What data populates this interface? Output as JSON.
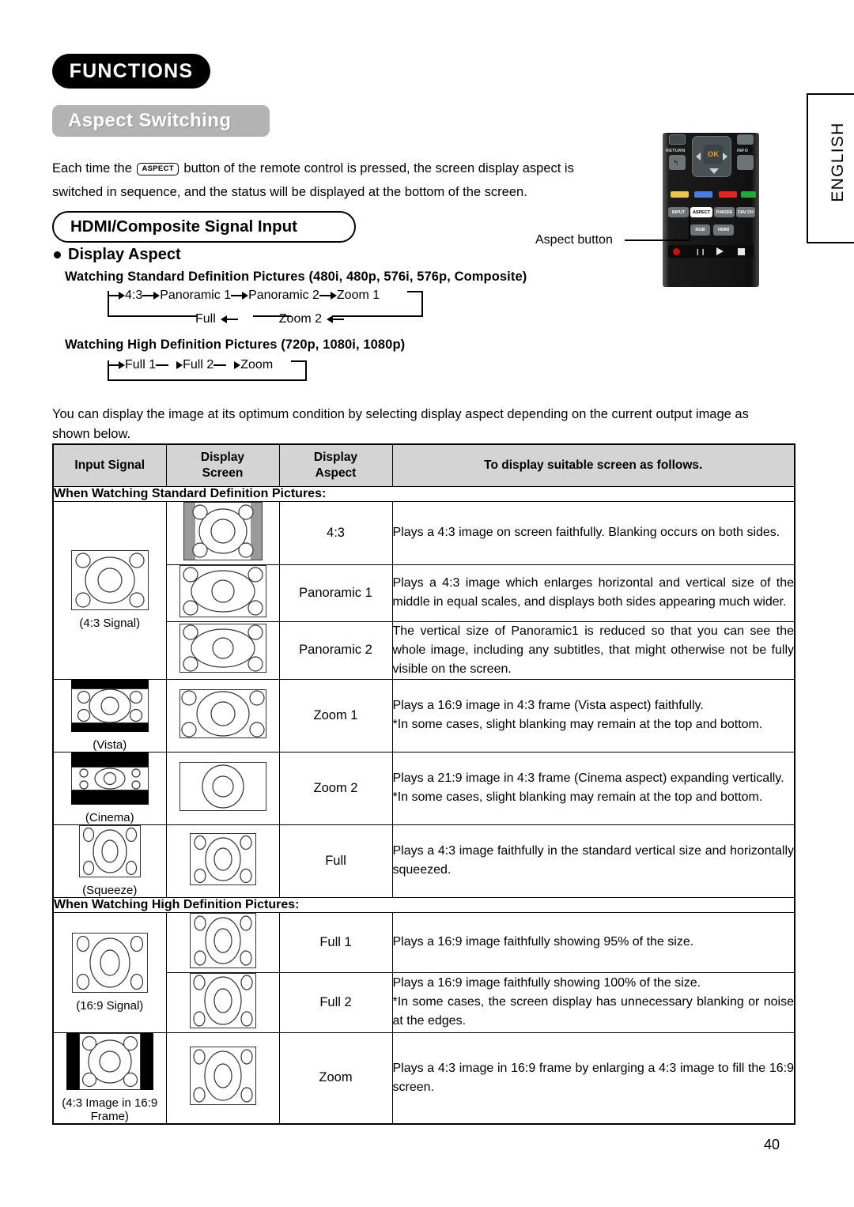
{
  "header": {
    "section_badge": "FUNCTIONS",
    "title_badge": "Aspect Switching"
  },
  "intro": {
    "before_key": "Each time the",
    "key_label": "ASPECT",
    "after_key": "button of the remote control is pressed, the screen display aspect is switched in sequence, and the status will be displayed at the bottom of the screen."
  },
  "hdmi_section": {
    "capsule_title": "HDMI/Composite Signal Input",
    "display_aspect_label": "Display Aspect",
    "sd_heading": "Watching Standard Definition Pictures (480i, 480p, 576i, 576p, Composite)",
    "hd_heading": "Watching High Definition Pictures (720p, 1080i, 1080p)",
    "sd_flow_top": [
      "4:3",
      "Panoramic 1",
      "Panoramic 2",
      "Zoom 1"
    ],
    "sd_flow_bottom": [
      "Full",
      "Zoom 2"
    ],
    "hd_flow": [
      "Full 1",
      "Full 2",
      "Zoom"
    ]
  },
  "remote": {
    "return_label": "RETURN",
    "ok_label": "OK",
    "info_label": "INFO",
    "keys": [
      "INPUT",
      "ASPECT",
      "P.MODE",
      "FAV CH"
    ],
    "source_keys": [
      "RGB",
      "HDMI"
    ],
    "color_keys": [
      "#e8c55a",
      "#4a7ddd",
      "#e22424",
      "#24a838"
    ],
    "callout": "Aspect button"
  },
  "sidebar": {
    "language_label": "ENGLISH"
  },
  "body_paragraph": "You can display the image at its optimum condition by selecting display aspect depending on the current output image as shown below.",
  "table": {
    "headers": [
      "Input Signal",
      "Display Screen",
      "Display Aspect",
      "To display suitable screen as follows."
    ],
    "section_sd": "When Watching Standard Definition Pictures:",
    "section_hd": "When Watching High Definition Pictures:",
    "input_labels": {
      "sd43": "(4:3 Signal)",
      "vista": "(Vista)",
      "cinema": "(Cinema)",
      "squeeze": "(Squeeze)",
      "hd169": "(16:9 Signal)",
      "frame43": "(4:3 Image in 16:9 Frame)"
    },
    "rows_sd": [
      {
        "aspect": "4:3",
        "desc": "Plays a 4:3 image on screen faithfully. Blanking occurs on both sides."
      },
      {
        "aspect": "Panoramic 1",
        "desc": "Plays a 4:3 image which enlarges horizontal and vertical size of the middle in equal scales, and displays both sides appearing much wider."
      },
      {
        "aspect": "Panoramic 2",
        "desc": "The vertical size of Panoramic1 is reduced so that you can see the whole image, including any subtitles, that might otherwise not be fully visible on the screen."
      },
      {
        "aspect": "Zoom 1",
        "desc": "Plays a 16:9 image in 4:3 frame (Vista aspect) faithfully.",
        "desc2": "*In some cases, slight blanking may remain at the top and bottom."
      },
      {
        "aspect": "Zoom 2",
        "desc": "Plays a 21:9 image in 4:3 frame (Cinema aspect) expanding vertically.",
        "desc2": "*In some cases, slight blanking may remain at the top and bottom."
      },
      {
        "aspect": "Full",
        "desc": "Plays a 4:3 image faithfully in the standard vertical size and horizontally squeezed."
      }
    ],
    "rows_hd": [
      {
        "aspect": "Full 1",
        "desc": "Plays a 16:9 image faithfully showing 95% of the size."
      },
      {
        "aspect": "Full 2",
        "desc": "Plays a 16:9 image faithfully showing 100% of the size.",
        "desc2": "*In some cases, the screen display has unnecessary blanking or noise at the edges."
      },
      {
        "aspect": "Zoom",
        "desc": "Plays a 4:3 image in 16:9 frame by enlarging a 4:3 image to fill the 16:9 screen."
      }
    ]
  },
  "page_number": "40",
  "colors": {
    "badge_black": "#000000",
    "badge_gray": "#b3b3b3",
    "table_header_gray": "#d4d4d4",
    "blanking_gray": "#9a9a9a",
    "remote_accent": "#e8a020"
  }
}
